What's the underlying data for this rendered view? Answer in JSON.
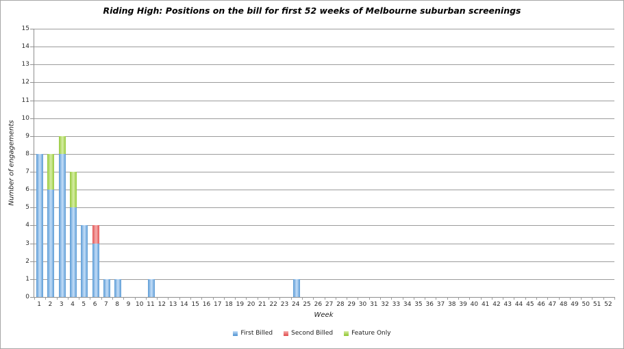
{
  "chart_data": {
    "type": "bar",
    "stacked": true,
    "title": "Riding High: Positions on the bill for first 52 weeks of Melbourne suburban screenings",
    "xlabel": "Week",
    "ylabel": "Number of engagements",
    "ylim": [
      0,
      15
    ],
    "ytick_step": 1,
    "ytick_labels": [
      "0",
      "1",
      "2",
      "3",
      "4",
      "5",
      "6",
      "7",
      "8",
      "9",
      "10",
      "11",
      "12",
      "13",
      "14",
      "15"
    ],
    "grid": true,
    "legend_position": "bottom-center",
    "categories": [
      1,
      2,
      3,
      4,
      5,
      6,
      7,
      8,
      9,
      10,
      11,
      12,
      13,
      14,
      15,
      16,
      17,
      18,
      19,
      20,
      21,
      22,
      23,
      24,
      25,
      26,
      27,
      28,
      29,
      30,
      31,
      32,
      33,
      34,
      35,
      36,
      37,
      38,
      39,
      40,
      41,
      42,
      43,
      44,
      45,
      46,
      47,
      48,
      49,
      50,
      51,
      52
    ],
    "series": [
      {
        "name": "First Billed",
        "color": "#5b9bd5",
        "color_light": "#c3ddf8",
        "values": [
          8,
          6,
          8,
          5,
          4,
          3,
          1,
          1,
          0,
          0,
          1,
          0,
          0,
          0,
          0,
          0,
          0,
          0,
          0,
          0,
          0,
          0,
          0,
          1,
          0,
          0,
          0,
          0,
          0,
          0,
          0,
          0,
          0,
          0,
          0,
          0,
          0,
          0,
          0,
          0,
          0,
          0,
          0,
          0,
          0,
          0,
          0,
          0,
          0,
          0,
          0,
          0
        ]
      },
      {
        "name": "Second Billed",
        "color": "#e25757",
        "color_light": "#f5adad",
        "values": [
          0,
          0,
          0,
          0,
          0,
          1,
          0,
          0,
          0,
          0,
          0,
          0,
          0,
          0,
          0,
          0,
          0,
          0,
          0,
          0,
          0,
          0,
          0,
          0,
          0,
          0,
          0,
          0,
          0,
          0,
          0,
          0,
          0,
          0,
          0,
          0,
          0,
          0,
          0,
          0,
          0,
          0,
          0,
          0,
          0,
          0,
          0,
          0,
          0,
          0,
          0,
          0
        ]
      },
      {
        "name": "Feature Only",
        "color": "#97ca3e",
        "color_light": "#d6eda3",
        "values": [
          0,
          2,
          1,
          2,
          0,
          0,
          0,
          0,
          0,
          0,
          0,
          0,
          0,
          0,
          0,
          0,
          0,
          0,
          0,
          0,
          0,
          0,
          0,
          0,
          0,
          0,
          0,
          0,
          0,
          0,
          0,
          0,
          0,
          0,
          0,
          0,
          0,
          0,
          0,
          0,
          0,
          0,
          0,
          0,
          0,
          0,
          0,
          0,
          0,
          0,
          0,
          0
        ]
      }
    ],
    "axis_color": "#8e8e8e",
    "gridline_color": "#9b9b9b"
  }
}
